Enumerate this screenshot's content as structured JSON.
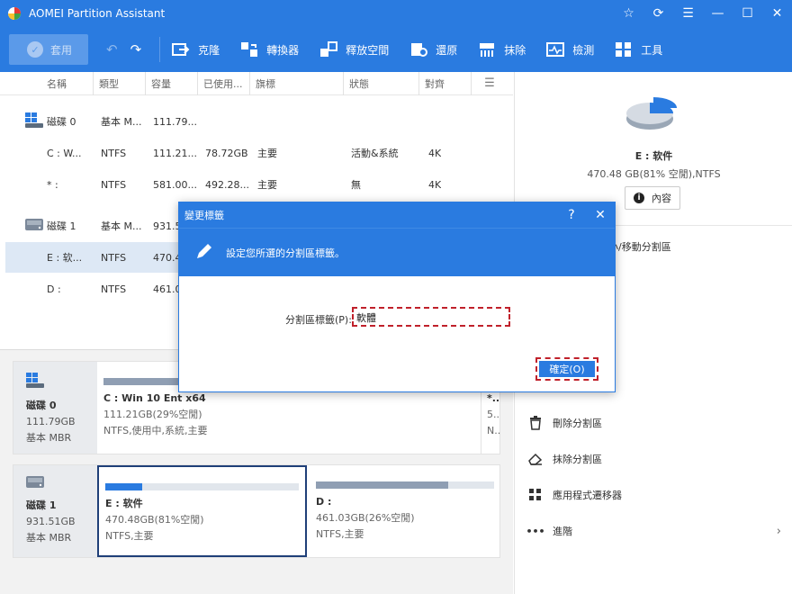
{
  "app": {
    "title": "AOMEI Partition Assistant"
  },
  "toolbar": {
    "apply_label": "套用",
    "tools": [
      {
        "label": "克隆",
        "icon": "clone-icon"
      },
      {
        "label": "轉換器",
        "icon": "converter-icon"
      },
      {
        "label": "釋放空間",
        "icon": "free-space-icon"
      },
      {
        "label": "還原",
        "icon": "recover-icon"
      },
      {
        "label": "抹除",
        "icon": "wipe-icon"
      },
      {
        "label": "檢測",
        "icon": "test-icon"
      },
      {
        "label": "工具",
        "icon": "tools-icon"
      }
    ]
  },
  "table": {
    "headers": [
      "名稱",
      "類型",
      "容量",
      "已使用...",
      "旗標",
      "狀態",
      "對齊"
    ],
    "rows": [
      {
        "kind": "disk",
        "name": "磁碟 0",
        "type": "基本 M...",
        "capacity": "111.79...",
        "used": "",
        "flag": "",
        "status": "",
        "align": ""
      },
      {
        "kind": "part",
        "name": "C : W...",
        "type": "NTFS",
        "capacity": "111.21...",
        "used": "78.72GB",
        "flag": "主要",
        "status": "活動&系統",
        "align": "4K"
      },
      {
        "kind": "part",
        "name": "* :",
        "type": "NTFS",
        "capacity": "581.00...",
        "used": "492.28...",
        "flag": "主要",
        "status": "無",
        "align": "4K"
      },
      {
        "kind": "disk",
        "name": "磁碟 1",
        "type": "基本 M...",
        "capacity": "931.5",
        "used": "",
        "flag": "",
        "status": "",
        "align": ""
      },
      {
        "kind": "part",
        "name": "E : 软...",
        "type": "NTFS",
        "capacity": "470.4",
        "used": "",
        "flag": "",
        "status": "",
        "align": ""
      },
      {
        "kind": "part",
        "name": "D :",
        "type": "NTFS",
        "capacity": "461.0",
        "used": "",
        "flag": "",
        "status": "",
        "align": ""
      }
    ]
  },
  "diskmap": {
    "disk0": {
      "name": "磁碟 0",
      "size": "111.79GB",
      "type": "基本 MBR",
      "partitions": [
        {
          "name": "C : Win 10 Ent x64",
          "info": "111.21GB(29%空閒)",
          "fs": "NTFS,使用中,系統,主要",
          "used_fraction": 0.71
        },
        {
          "name": "*...",
          "info": "5...",
          "fs": "N..."
        }
      ]
    },
    "disk1": {
      "name": "磁碟 1",
      "size": "931.51GB",
      "type": "基本 MBR",
      "partitions": [
        {
          "name": "E : 软件",
          "info": "470.48GB(81%空閒)",
          "fs": "NTFS,主要",
          "used_fraction": 0.19
        },
        {
          "name": "D :",
          "info": "461.03GB(26%空閒)",
          "fs": "NTFS,主要",
          "used_fraction": 0.74
        }
      ]
    }
  },
  "right_panel": {
    "title": "E : 软件",
    "subtitle": "470.48 GB(81% 空閒),NTFS",
    "props_label": "內容",
    "partial_item": "小/移動分割區",
    "items": [
      {
        "label": "刪除分割區",
        "icon": "trash-icon"
      },
      {
        "label": "抹除分割區",
        "icon": "eraser-icon"
      },
      {
        "label": "應用程式遷移器",
        "icon": "app-mover-icon"
      },
      {
        "label": "進階",
        "icon": "more-icon"
      }
    ]
  },
  "dialog": {
    "title": "變更標籤",
    "help": "?",
    "instruction": "設定您所選的分割區標籤。",
    "field_label": "分割區標籤(P):",
    "field_value": "軟體",
    "ok_label": "確定(O)"
  },
  "colors": {
    "primary": "#2a7be0",
    "highlight_dash": "#c0212b",
    "bar_used": "#2a7be0",
    "bar_other": "#8f9eb3"
  }
}
